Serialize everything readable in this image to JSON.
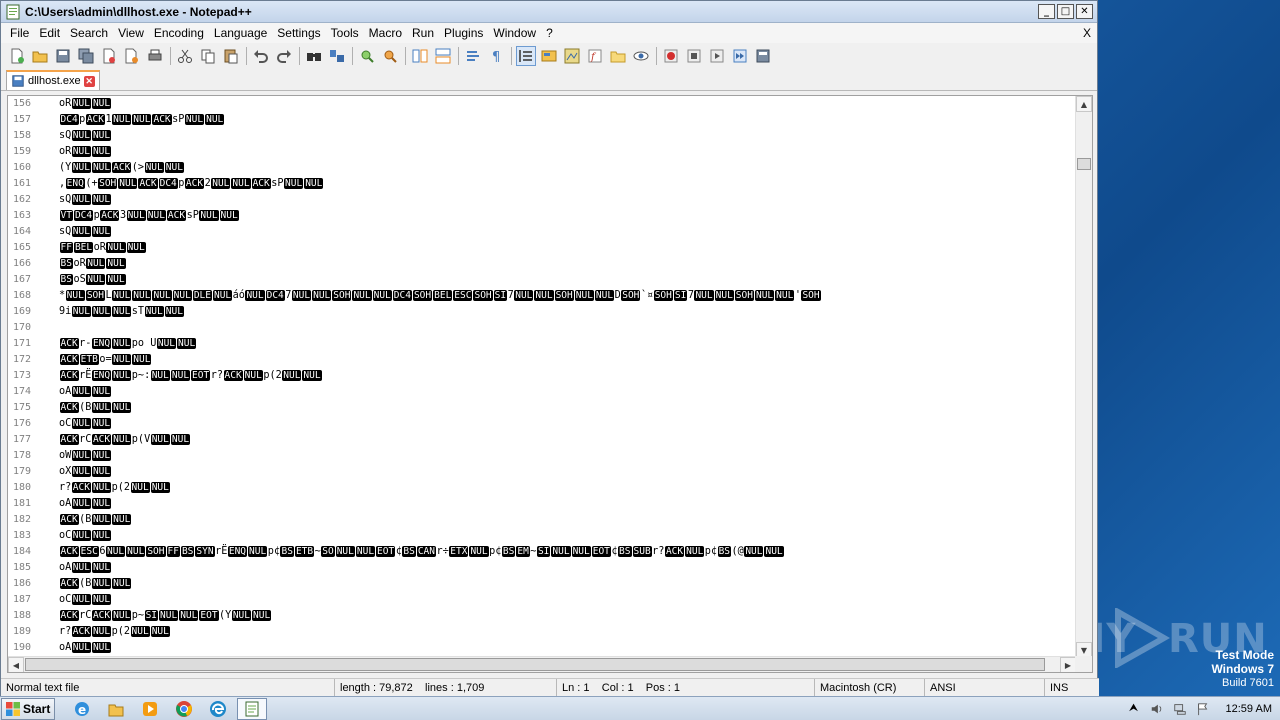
{
  "window": {
    "title": "C:\\Users\\admin\\dllhost.exe - Notepad++"
  },
  "menu": [
    "File",
    "Edit",
    "Search",
    "View",
    "Encoding",
    "Language",
    "Settings",
    "Tools",
    "Macro",
    "Run",
    "Plugins",
    "Window",
    "?"
  ],
  "menu_close": "X",
  "toolbar_icons": [
    "new-file-icon",
    "open-file-icon",
    "save-icon",
    "save-all-icon",
    "close-icon",
    "close-all-icon",
    "print-icon",
    "cut-icon",
    "copy-icon",
    "paste-icon",
    "undo-icon",
    "redo-icon",
    "find-icon",
    "replace-icon",
    "zoom-in-icon",
    "zoom-out-icon",
    "sync-v-icon",
    "sync-h-icon",
    "word-wrap-icon",
    "show-all-chars-icon",
    "indent-guide-icon",
    "user-lang-icon",
    "doc-map-icon",
    "function-list-icon",
    "folder-workspace-icon",
    "monitor-icon",
    "record-macro-icon",
    "stop-record-icon",
    "play-macro-icon",
    "run-macro-multiple-icon",
    "save-macro-icon"
  ],
  "tab": {
    "label": "dllhost.exe"
  },
  "editor": {
    "lines": [
      {
        "n": "156",
        "t": "oR{NUL}{NUL}"
      },
      {
        "n": "157",
        "t": "{DC4}p{ACK}1{NUL}{NUL}{ACK}sP{NUL}{NUL}"
      },
      {
        "n": "158",
        "t": "sQ{NUL}{NUL}"
      },
      {
        "n": "159",
        "t": "oR{NUL}{NUL}"
      },
      {
        "n": "160",
        "t": "(Y{NUL}{NUL}{ACK}(>{NUL}{NUL}"
      },
      {
        "n": "161",
        "t": ",{ENQ}(+{SOH}{NUL}{ACK}{DC4}p{ACK}2{NUL}{NUL}{ACK}sP{NUL}{NUL}"
      },
      {
        "n": "162",
        "t": "sQ{NUL}{NUL}"
      },
      {
        "n": "163",
        "t": "{VT}{DC4}p{ACK}3{NUL}{NUL}{ACK}sP{NUL}{NUL}"
      },
      {
        "n": "164",
        "t": "sQ{NUL}{NUL}"
      },
      {
        "n": "165",
        "t": "{FF}{BEL}oR{NUL}{NUL}"
      },
      {
        "n": "166",
        "t": "{BS}oR{NUL}{NUL}"
      },
      {
        "n": "167",
        "t": "{BS}oS{NUL}{NUL}"
      },
      {
        "n": "168",
        "t": "*{NUL}{SOH}L{NUL}{NUL}{NUL}{NUL}{DLE}{NUL}áó{NUL}{DC4}7{NUL}{NUL}{SOH}{NUL}{NUL}{DC4}{SOH}{BEL}{ESC}{SOH}{SI}7{NUL}{NUL}{SOH}{NUL}{NUL}D{SOH}`¤{SOH}{SI}7{NUL}{NUL}{SOH}{NUL}{NUL}'{SOH}"
      },
      {
        "n": "169",
        "t": "9i{NUL}{NUL}{NUL}sT{NUL}{NUL}"
      },
      {
        "n": "170",
        "t": ""
      },
      {
        "n": "171",
        "t": "{ACK}r-{ENQ}{NUL}po U{NUL}{NUL}"
      },
      {
        "n": "172",
        "t": "{ACK}{ETB}o={NUL}{NUL}"
      },
      {
        "n": "173",
        "t": "{ACK}rË{ENQ}{NUL}p~:{NUL}{NUL}{EOT}r?{ACK}{NUL}p(2{NUL}{NUL}"
      },
      {
        "n": "174",
        "t": "oA{NUL}{NUL}"
      },
      {
        "n": "175",
        "t": "{ACK}(B{NUL}{NUL}"
      },
      {
        "n": "176",
        "t": "oC{NUL}{NUL}"
      },
      {
        "n": "177",
        "t": "{ACK}rC{ACK}{NUL}p(V{NUL}{NUL}"
      },
      {
        "n": "178",
        "t": "oW{NUL}{NUL}"
      },
      {
        "n": "179",
        "t": "oX{NUL}{NUL}"
      },
      {
        "n": "180",
        "t": "r?{ACK}{NUL}p(2{NUL}{NUL}"
      },
      {
        "n": "181",
        "t": "oA{NUL}{NUL}"
      },
      {
        "n": "182",
        "t": "{ACK}(B{NUL}{NUL}"
      },
      {
        "n": "183",
        "t": "oC{NUL}{NUL}"
      },
      {
        "n": "184",
        "t": "{ACK}{ESC}6{NUL}{NUL}{SOH}{FF}{BS}{SYN}rË{ENQ}{NUL}p¢{BS}{ETB}~{SO}{NUL}{NUL}{EOT}¢{BS}{CAN}r÷{ETX}{NUL}p¢{BS}{EM}~{SI}{NUL}{NUL}{EOT}¢{BS}{SUB}r?{ACK}{NUL}p¢{BS}(@{NUL}{NUL}"
      },
      {
        "n": "185",
        "t": "oA{NUL}{NUL}"
      },
      {
        "n": "186",
        "t": "{ACK}(B{NUL}{NUL}"
      },
      {
        "n": "187",
        "t": "oC{NUL}{NUL}"
      },
      {
        "n": "188",
        "t": "{ACK}rC{ACK}{NUL}p~{SI}{NUL}{NUL}{EOT}(Y{NUL}{NUL}"
      },
      {
        "n": "189",
        "t": "r?{ACK}{NUL}p(2{NUL}{NUL}"
      },
      {
        "n": "190",
        "t": "oA{NUL}{NUL}"
      }
    ]
  },
  "statusbar": {
    "type": "Normal text file",
    "length": "length : 79,872",
    "lines": "lines : 1,709",
    "ln": "Ln : 1",
    "col": "Col : 1",
    "pos": "Pos : 1",
    "eol": "Macintosh (CR)",
    "encoding": "ANSI",
    "mode": "INS"
  },
  "desktop": {
    "testmode_1": "Test Mode",
    "testmode_2": "Windows 7",
    "testmode_3": "Build 7601",
    "watermark_left": "ANY",
    "watermark_right": "RUN"
  },
  "taskbar": {
    "start": "Start",
    "apps": [
      "ie-icon",
      "explorer-icon",
      "media-player-icon",
      "chrome-icon",
      "edge-icon",
      "notepadpp-icon"
    ],
    "clock": "12:59 AM"
  }
}
